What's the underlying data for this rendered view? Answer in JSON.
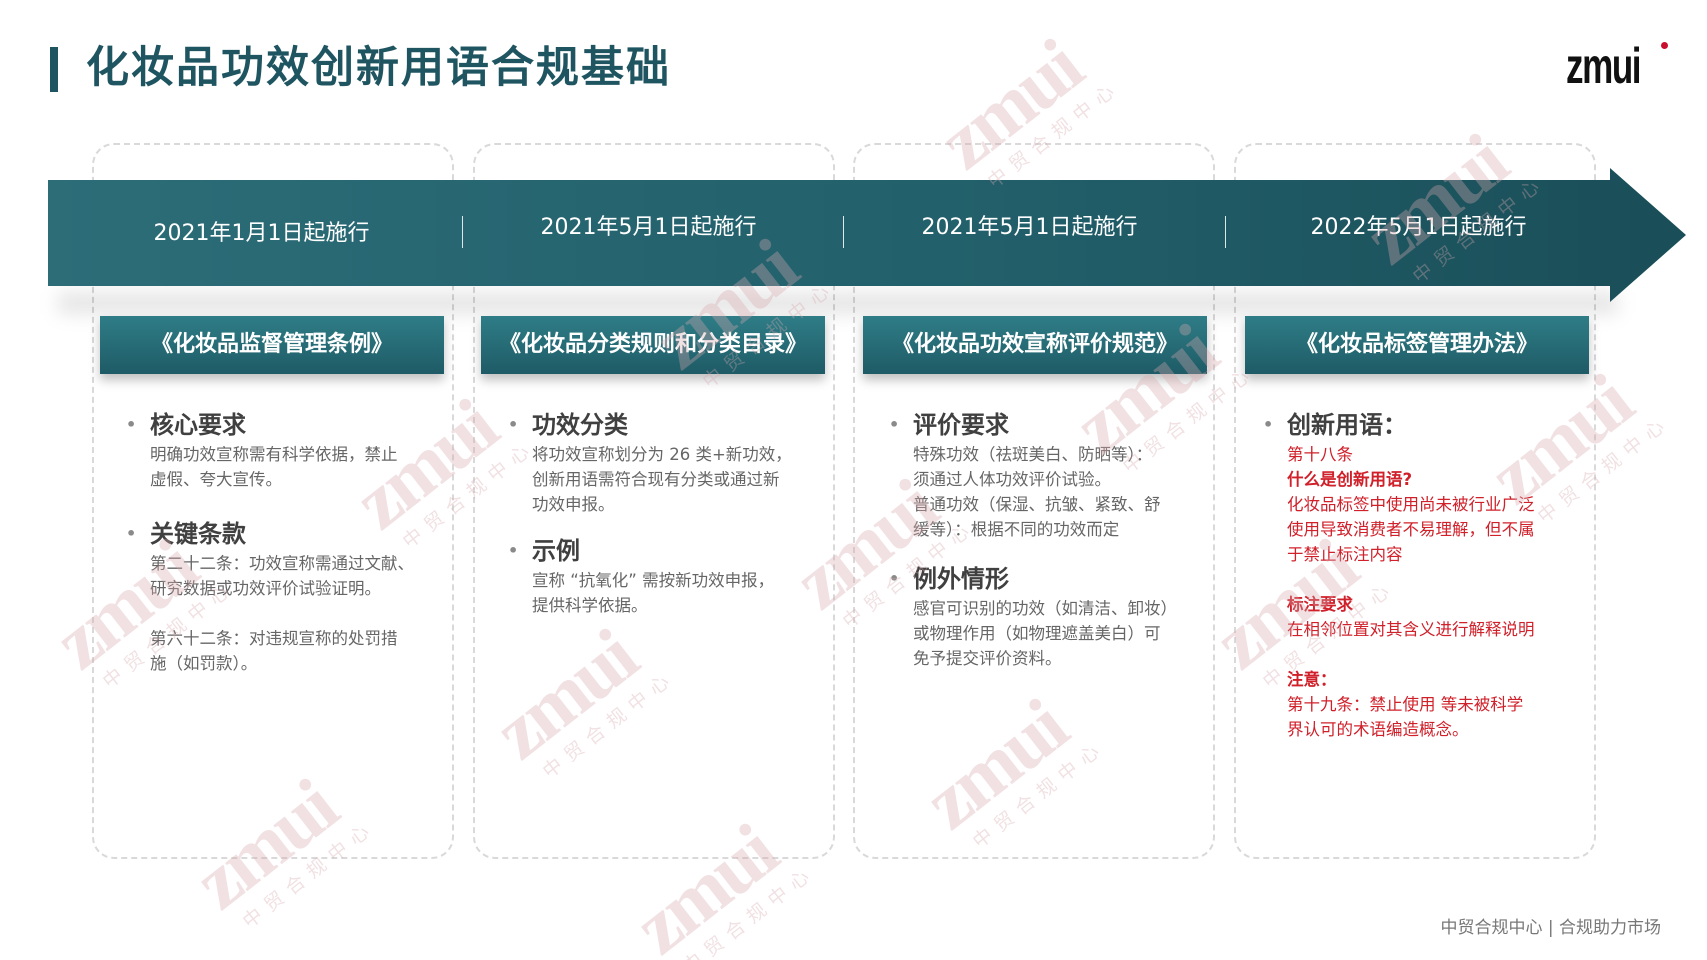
{
  "header": {
    "title": "化妆品功效创新用语合规基础",
    "logo_text": "zmui"
  },
  "watermark": {
    "main": "zmui",
    "sub": "中贸合规中心"
  },
  "timeline": [
    {
      "date": "2021年1月1日起施行",
      "regulation": "《化妆品监督管理条例》",
      "sections": [
        {
          "heading": "核心要求",
          "lines": [
            "明确功效宣称需有科学依据，禁止",
            "虚假、夸大宣传。"
          ]
        },
        {
          "heading": "关键条款",
          "lines": [
            "第二十二条：功效宣称需通过文献、",
            "研究数据或功效评价试验证明。"
          ],
          "lines2": [
            "第六十二条：对违规宣称的处罚措",
            "施（如罚款）。"
          ]
        }
      ]
    },
    {
      "date": "2021年5月1日起施行",
      "regulation": "《化妆品分类规则和分类目录》",
      "sections": [
        {
          "heading": "功效分类",
          "lines": [
            "将功效宣称划分为 26 类+新功效，",
            "创新用语需符合现有分类或通过新",
            "功效申报。"
          ]
        },
        {
          "heading": "示例",
          "lines": [
            "宣称 “抗氧化” 需按新功效申报，",
            "提供科学依据。"
          ]
        }
      ]
    },
    {
      "date": "2021年5月1日起施行",
      "regulation": "《化妆品功效宣称评价规范》",
      "sections": [
        {
          "heading": "评价要求",
          "lines": [
            "特殊功效（祛斑美白、防晒等）：",
            "须通过人体功效评价试验。",
            "普通功效（保湿、抗皱、紧致、舒",
            "缓等）：根据不同的功效而定"
          ]
        },
        {
          "heading": "例外情形",
          "lines": [
            "感官可识别的功效（如清洁、卸妆）",
            "或物理作用（如物理遮盖美白）可",
            "免予提交评价资料。"
          ]
        }
      ]
    },
    {
      "date": "2022年5月1日起施行",
      "regulation": "《化妆品标签管理办法》",
      "sections": [
        {
          "heading": "创新用语：",
          "article": "第十八条",
          "q_title": "什么是创新用语?",
          "q_lines": [
            "化妆品标签中使用尚未被行业广泛",
            "使用导致消费者不易理解，但不属",
            "于禁止标注内容"
          ],
          "req_title": "标注要求",
          "req_line": "在相邻位置对其含义进行解释说明",
          "note_title": "注意：",
          "note_lines": [
            "第十九条：禁止使用 等未被科学",
            "界认可的术语编造概念。"
          ]
        }
      ]
    }
  ],
  "footer": "中贸合规中心 | 合规助力市场"
}
